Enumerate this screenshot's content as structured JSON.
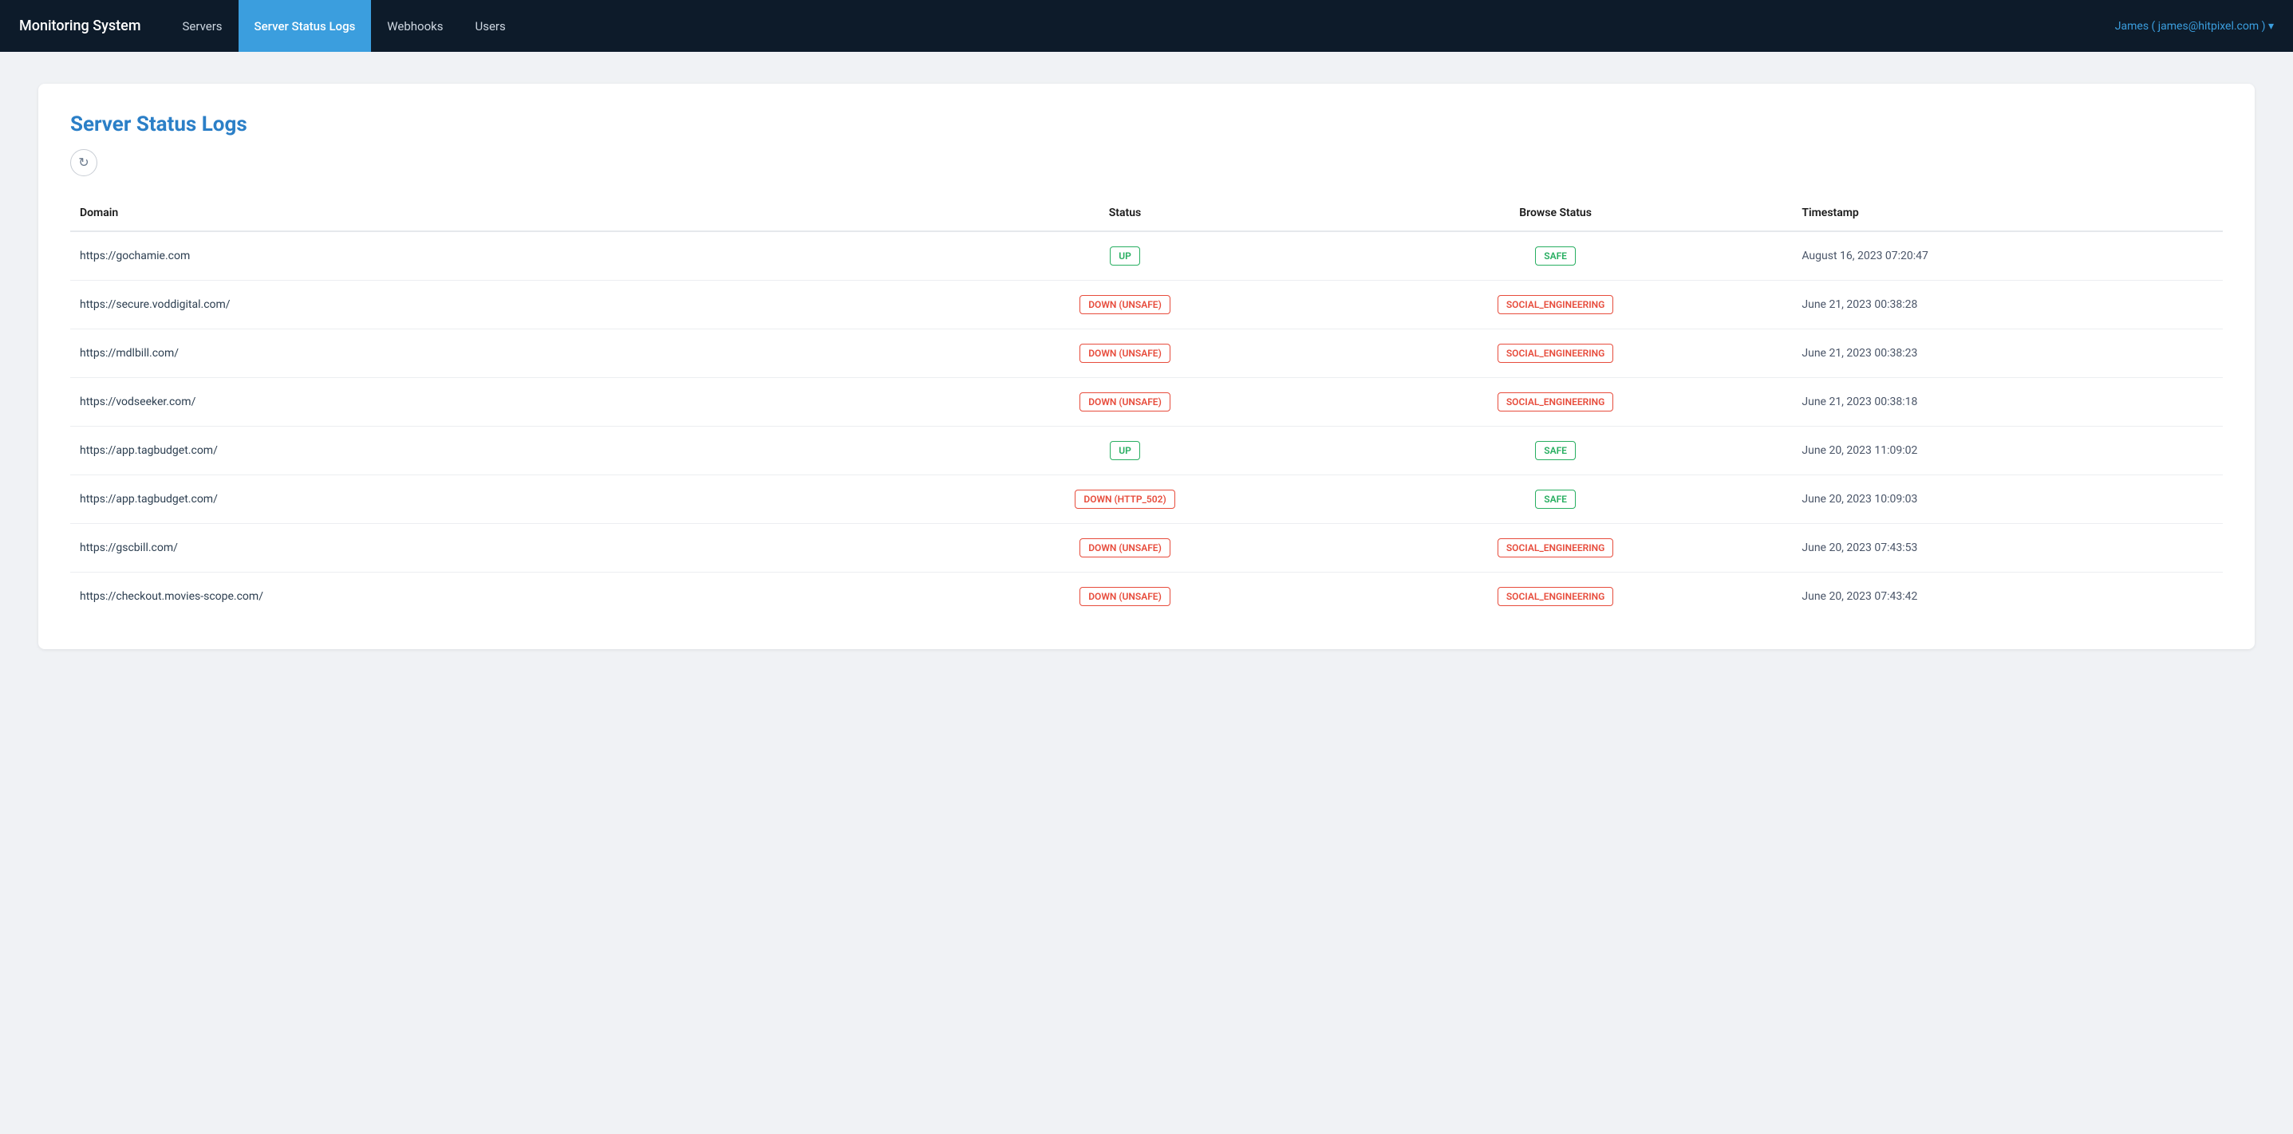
{
  "app": {
    "brand": "Monitoring System",
    "user": "James ( james@hitpixel.com ) ▾"
  },
  "nav": {
    "links": [
      {
        "label": "Servers",
        "active": false
      },
      {
        "label": "Server Status Logs",
        "active": true
      },
      {
        "label": "Webhooks",
        "active": false
      },
      {
        "label": "Users",
        "active": false
      }
    ]
  },
  "page": {
    "title": "Server Status Logs",
    "refresh_label": "↻"
  },
  "table": {
    "columns": {
      "domain": "Domain",
      "status": "Status",
      "browse_status": "Browse Status",
      "timestamp": "Timestamp"
    },
    "rows": [
      {
        "domain": "https://gochamie.com",
        "status": "UP",
        "status_type": "up",
        "browse_status": "SAFE",
        "browse_type": "safe",
        "timestamp": "August 16, 2023 07:20:47"
      },
      {
        "domain": "https://secure.voddigital.com/",
        "status": "DOWN (UNSAFE)",
        "status_type": "down-unsafe",
        "browse_status": "SOCIAL_ENGINEERING",
        "browse_type": "social",
        "timestamp": "June 21, 2023 00:38:28"
      },
      {
        "domain": "https://mdlbill.com/",
        "status": "DOWN (UNSAFE)",
        "status_type": "down-unsafe",
        "browse_status": "SOCIAL_ENGINEERING",
        "browse_type": "social",
        "timestamp": "June 21, 2023 00:38:23"
      },
      {
        "domain": "https://vodseeker.com/",
        "status": "DOWN (UNSAFE)",
        "status_type": "down-unsafe",
        "browse_status": "SOCIAL_ENGINEERING",
        "browse_type": "social",
        "timestamp": "June 21, 2023 00:38:18"
      },
      {
        "domain": "https://app.tagbudget.com/",
        "status": "UP",
        "status_type": "up",
        "browse_status": "SAFE",
        "browse_type": "safe",
        "timestamp": "June 20, 2023 11:09:02"
      },
      {
        "domain": "https://app.tagbudget.com/",
        "status": "DOWN (HTTP_502)",
        "status_type": "down-http",
        "browse_status": "SAFE",
        "browse_type": "safe",
        "timestamp": "June 20, 2023 10:09:03"
      },
      {
        "domain": "https://gscbill.com/",
        "status": "DOWN (UNSAFE)",
        "status_type": "down-unsafe",
        "browse_status": "SOCIAL_ENGINEERING",
        "browse_type": "social",
        "timestamp": "June 20, 2023 07:43:53"
      },
      {
        "domain": "https://checkout.movies-scope.com/",
        "status": "DOWN (UNSAFE)",
        "status_type": "down-unsafe",
        "browse_status": "SOCIAL_ENGINEERING",
        "browse_type": "social",
        "timestamp": "June 20, 2023 07:43:42"
      }
    ]
  }
}
